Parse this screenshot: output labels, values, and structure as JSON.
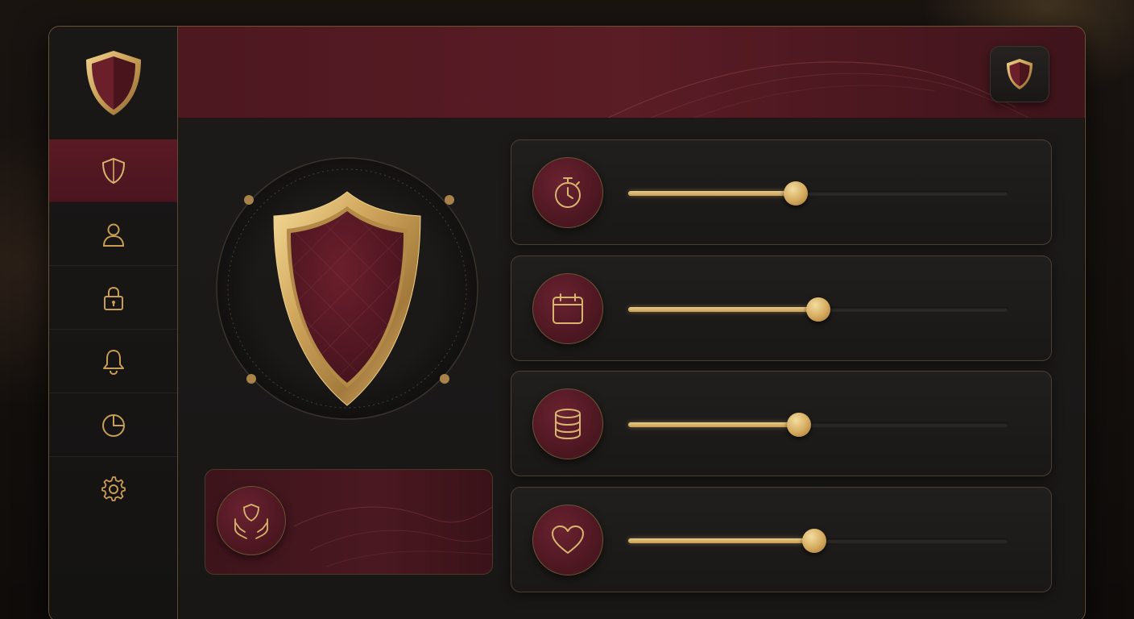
{
  "theme": {
    "accent": "#c89d55",
    "maroon": "#5a1c25",
    "background": "#181716"
  },
  "sidebar": {
    "logo_icon": "shield-icon",
    "items": [
      {
        "icon": "shield-icon",
        "active": true
      },
      {
        "icon": "user-icon",
        "active": false
      },
      {
        "icon": "lock-icon",
        "active": false
      },
      {
        "icon": "bell-icon",
        "active": false
      },
      {
        "icon": "pie-chart-icon",
        "active": false
      },
      {
        "icon": "gear-icon",
        "active": false
      }
    ]
  },
  "header": {
    "button_icon": "shield-icon"
  },
  "hero": {
    "icon": "shield-icon"
  },
  "feature_card": {
    "icon": "hands-shield-icon"
  },
  "sliders": [
    {
      "icon": "stopwatch-icon",
      "value": 0.44
    },
    {
      "icon": "calendar-icon",
      "value": 0.5
    },
    {
      "icon": "database-icon",
      "value": 0.45
    },
    {
      "icon": "heart-icon",
      "value": 0.49
    }
  ]
}
